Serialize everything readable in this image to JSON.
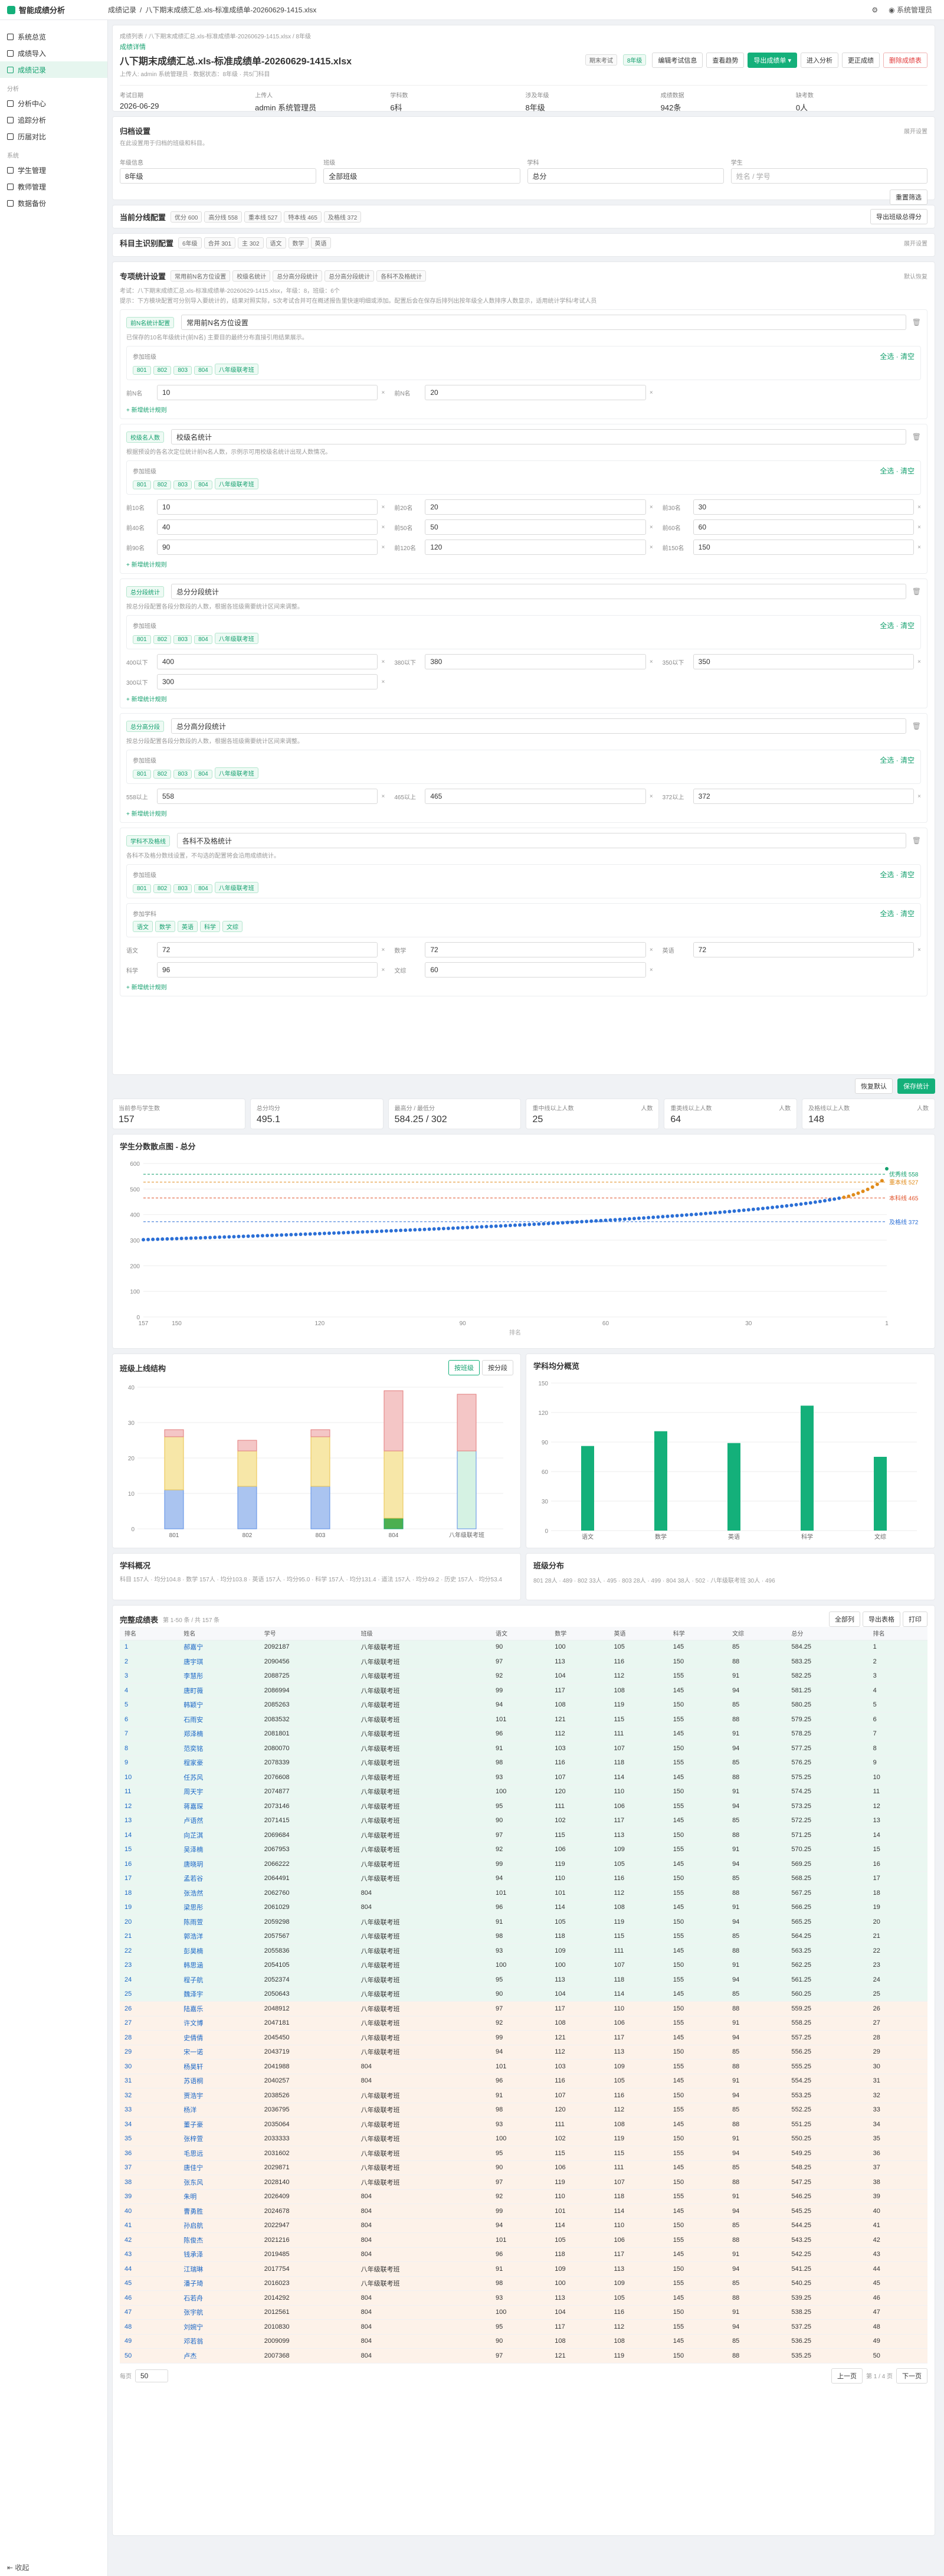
{
  "app": {
    "title": "智能成绩分析",
    "user": "系统管理员"
  },
  "breadcrumb": [
    "成绩记录",
    "/",
    "八下期末成绩汇总.xls-标准成绩单-20260629-1415.xlsx"
  ],
  "sidebar": {
    "groups": [
      {
        "label": "",
        "items": [
          {
            "label": "系统总览",
            "active": false
          },
          {
            "label": "成绩导入",
            "active": false
          },
          {
            "label": "成绩记录",
            "active": true
          }
        ]
      },
      {
        "label": "分析",
        "items": [
          {
            "label": "分析中心",
            "active": false
          },
          {
            "label": "追踪分析",
            "active": false
          },
          {
            "label": "历届对比",
            "active": false
          }
        ]
      },
      {
        "label": "系统",
        "items": [
          {
            "label": "学生管理",
            "active": false
          },
          {
            "label": "教师管理",
            "active": false
          },
          {
            "label": "数据备份",
            "active": false
          }
        ]
      }
    ],
    "collapse": "收起"
  },
  "header": {
    "path": "成绩列表 / 八下期末成绩汇总.xls-标准成绩单-20260629-1415.xlsx / 8年级",
    "status": "成绩详情",
    "title": "八下期末成绩汇总.xls-标准成绩单-20260629-1415.xlsx",
    "meta": "上传人: admin 系统管理员 · 数据状态：8年级 · 共5门科目",
    "badges": [
      "期末考试",
      "8年级"
    ],
    "buttons": {
      "edit": "编辑考试信息",
      "view": "查看趋势",
      "export": "导出成绩单 ▾",
      "enter": "进入分析",
      "replace": "更正成绩",
      "delete": "删除成绩表"
    },
    "info": [
      {
        "label": "考试日期",
        "value": "2026-06-29"
      },
      {
        "label": "上传人",
        "value": "admin 系统管理员"
      },
      {
        "label": "学科数",
        "value": "6科"
      },
      {
        "label": "涉及年级",
        "value": "8年级"
      },
      {
        "label": "成绩数据",
        "value": "942条"
      },
      {
        "label": "缺考数",
        "value": "0人"
      }
    ]
  },
  "filter": {
    "title": "归档设置",
    "desc": "在此设置用于归档的班级和科目。",
    "collapse": "展开设置",
    "fields": [
      {
        "label": "年级信息",
        "value": "8年级",
        "ph": false
      },
      {
        "label": "班级",
        "value": "全部班级",
        "ph": false
      },
      {
        "label": "学科",
        "value": "总分",
        "ph": false
      },
      {
        "label": "学生",
        "value": "姓名 / 学号",
        "ph": true
      }
    ],
    "btn": "重置筛选"
  },
  "lines": {
    "title": "当前分线配置",
    "items": [
      "优分 600",
      "高分线 558",
      "重本线 527",
      "特本线 465",
      "及格线 372"
    ],
    "btn": "导出班级总得分"
  },
  "subjects": {
    "title": "科目主识别配置",
    "items": [
      "6年级",
      "合并 301",
      "主 302",
      "语文",
      "数学",
      "英语"
    ],
    "collapse": "展开设置"
  },
  "stats_cfg": {
    "title": "专项统计设置",
    "tabs": [
      "常用前N名方位设置",
      "校级名统计",
      "总分高分段统计",
      "总分高分段统计",
      "各科不及格统计"
    ],
    "note1": "考试：八下期末成绩汇总.xls-标准成绩单-20260629-1415.xlsx，年级：8，班级：6个",
    "note2": "提示：下方模块配置可分别导入要统计的，结果对照实际，5次考试合并可在概述报告里快速明细或添加。配置后会在保存后排列出按年级全人数排序人数显示，适用统计学科/考试人员",
    "reset": "默认恢复",
    "blocks": [
      {
        "tag": "前N名统计配置",
        "name": "常用前N名方位设置",
        "desc": "已保存的10名年级统计(前N名) 主要目的最终分布直接引用结果展示。",
        "chk_label": "参加班级",
        "sel": "全选 · 清空",
        "classes": [
          "801",
          "802",
          "803",
          "804",
          "八年级联考班"
        ],
        "rows": [
          [
            {
              "l": "前N名",
              "v": "10"
            },
            {
              "l": "前N名",
              "v": "20"
            }
          ]
        ]
      },
      {
        "tag": "校级名人数",
        "name": "校级名统计",
        "desc": "根据预设的各名次定位统计前N名人数，示例示可用校级名统计出现人数情况。",
        "chk_label": "参加班级",
        "sel": "全选 · 清空",
        "classes": [
          "801",
          "802",
          "803",
          "804",
          "八年级联考班"
        ],
        "rows": [
          [
            {
              "l": "前10名",
              "v": "10"
            },
            {
              "l": "前20名",
              "v": "20"
            },
            {
              "l": "前30名",
              "v": "30"
            }
          ],
          [
            {
              "l": "前40名",
              "v": "40"
            },
            {
              "l": "前50名",
              "v": "50"
            },
            {
              "l": "前60名",
              "v": "60"
            }
          ],
          [
            {
              "l": "前90名",
              "v": "90"
            },
            {
              "l": "前120名",
              "v": "120"
            },
            {
              "l": "前150名",
              "v": "150"
            }
          ]
        ]
      },
      {
        "tag": "总分段统计",
        "name": "总分分段统计",
        "desc": "按总分段配置各段分数段的人数，根据各班级需要统计区间来调整。",
        "chk_label": "参加班级",
        "sel": "全选 · 清空",
        "classes": [
          "801",
          "802",
          "803",
          "804",
          "八年级联考班"
        ],
        "rows": [
          [
            {
              "l": "400以下",
              "v": "400"
            },
            {
              "l": "380以下",
              "v": "380"
            },
            {
              "l": "350以下",
              "v": "350"
            }
          ],
          [
            {
              "l": "300以下",
              "v": "300"
            }
          ]
        ]
      },
      {
        "tag": "总分高分段",
        "name": "总分高分段统计",
        "desc": "按总分段配置各段分数段的人数，根据各班级需要统计区间来调整。",
        "chk_label": "参加班级",
        "sel": "全选 · 清空",
        "classes": [
          "801",
          "802",
          "803",
          "804",
          "八年级联考班"
        ],
        "rows": [
          [
            {
              "l": "558以上",
              "v": "558"
            },
            {
              "l": "465以上",
              "v": "465"
            },
            {
              "l": "372以上",
              "v": "372"
            }
          ]
        ]
      },
      {
        "tag": "学科不及格线",
        "name": "各科不及格统计",
        "desc": "各科不及格分数线设置，不勾选的配置将会沿用成绩统计。",
        "chk_label": "参加班级",
        "sel": "全选 · 清空",
        "classes": [
          "801",
          "802",
          "803",
          "804",
          "八年级联考班"
        ],
        "chk2_label": "参加学科",
        "classes2": [
          "语文",
          "数学",
          "英语",
          "科学",
          "文综"
        ],
        "rows": [
          [
            {
              "l": "语文",
              "v": "72"
            },
            {
              "l": "数学",
              "v": "72"
            },
            {
              "l": "英语",
              "v": "72"
            }
          ],
          [
            {
              "l": "科学",
              "v": "96"
            },
            {
              "l": "文综",
              "v": "60"
            }
          ]
        ]
      }
    ],
    "add": "+ 新增统计规则",
    "save_default": "恢复默认",
    "save": "保存统计"
  },
  "kpis": [
    {
      "label": "当前参与学生数",
      "value": "157",
      "unit": ""
    },
    {
      "label": "总分均分",
      "value": "495.1",
      "unit": ""
    },
    {
      "label": "最高分 / 最低分",
      "value": "584.25 / 302",
      "unit": ""
    },
    {
      "label": "重中线以上人数",
      "value": "25",
      "unit": "人数"
    },
    {
      "label": "重类线以上人数",
      "value": "64",
      "unit": "人数"
    },
    {
      "label": "及格线以上人数",
      "value": "148",
      "unit": "人数"
    }
  ],
  "scatter": {
    "title": "学生分数散点图 - 总分",
    "yticks": [
      0,
      100,
      200,
      300,
      400,
      500,
      600
    ],
    "xticks": [
      "157",
      "150",
      "120",
      "90",
      "60",
      "30",
      "1"
    ],
    "lines": [
      {
        "label": "优秀线 558",
        "value": 558,
        "color": "#14a06e"
      },
      {
        "label": "重本线 527",
        "value": 527,
        "color": "#e08b1a"
      },
      {
        "label": "本科线 465",
        "value": 465,
        "color": "#e0532b"
      },
      {
        "label": "及格线 372",
        "value": 372,
        "color": "#2b6fd6"
      }
    ],
    "xlabel": "排名"
  },
  "classchart": {
    "title": "班级上线结构",
    "toggle": [
      "按班级",
      "按分段"
    ],
    "classes": [
      "801",
      "802",
      "803",
      "804",
      "八年级联考班"
    ],
    "yticks": [
      0,
      10,
      20,
      30,
      40
    ]
  },
  "subjchart": {
    "title": "学科均分概览",
    "subjects": [
      "语文",
      "数学",
      "英语",
      "科学",
      "文综"
    ],
    "values": [
      86,
      101,
      89,
      127,
      75
    ],
    "yticks": [
      0,
      30,
      60,
      90,
      120,
      150
    ]
  },
  "subjsum": {
    "title": "学科概况",
    "text": "科目 157人 · 均分104.8  ·  数学 157人 · 均分103.8  ·  英语 157人 · 均分95.0  ·  科学 157人 · 均分131.4  ·  道法 157人 · 均分49.2  ·  历史 157人 · 均分53.4"
  },
  "classdist": {
    "title": "班级分布",
    "text": "801 28人 · 489  ·  802 33人 · 495  ·  803 28人 · 499  ·  804 38人 · 502  ·  八年级联考班 30人 · 496"
  },
  "table": {
    "title": "完整成绩表",
    "subtitle": "第 1-50 条 / 共 157 条",
    "actions": [
      "全部列",
      "导出表格",
      "打印"
    ],
    "headers": [
      "排名",
      "姓名",
      "学号",
      "班级",
      "语文",
      "数学",
      "英语",
      "科学",
      "文综",
      "总分",
      "排名"
    ],
    "footer_left": "每页",
    "page_size": "50",
    "pager": [
      "上一页",
      "第 1 / 4 页",
      "下一页"
    ]
  }
}
